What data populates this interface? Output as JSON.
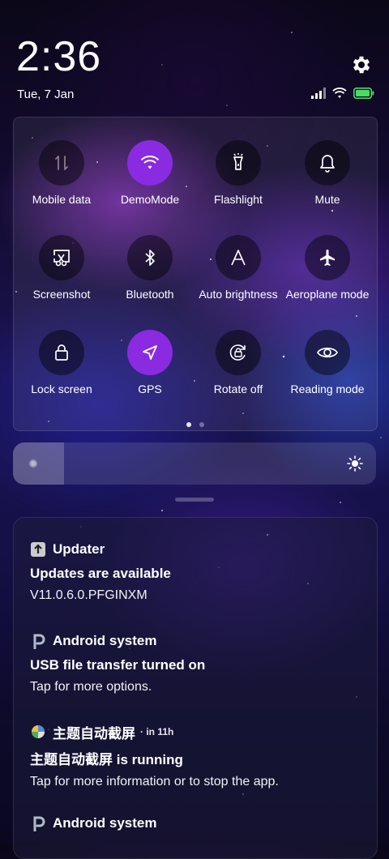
{
  "clock": {
    "time": "2:36",
    "date": "Tue, 7 Jan"
  },
  "colors": {
    "accent": "#8a2be2",
    "battery": "#4cd964"
  },
  "tiles": [
    {
      "label": "Mobile data",
      "icon": "mobile-data-icon",
      "state": "disabled"
    },
    {
      "label": "DemoMode",
      "icon": "wifi-icon",
      "state": "active"
    },
    {
      "label": "Flashlight",
      "icon": "flashlight-icon",
      "state": "off"
    },
    {
      "label": "Mute",
      "icon": "bell-icon",
      "state": "off"
    },
    {
      "label": "Screenshot",
      "icon": "screenshot-icon",
      "state": "off"
    },
    {
      "label": "Bluetooth",
      "icon": "bluetooth-icon",
      "state": "off"
    },
    {
      "label": "Auto brightness",
      "icon": "auto-brightness-icon",
      "state": "off"
    },
    {
      "label": "Aeroplane mode",
      "icon": "airplane-icon",
      "state": "off"
    },
    {
      "label": "Lock screen",
      "icon": "lock-icon",
      "state": "off"
    },
    {
      "label": "GPS",
      "icon": "gps-icon",
      "state": "active"
    },
    {
      "label": "Rotate off",
      "icon": "rotate-lock-icon",
      "state": "off"
    },
    {
      "label": "Reading mode",
      "icon": "eye-icon",
      "state": "off"
    }
  ],
  "pager": {
    "pages": 2,
    "current": 1
  },
  "brightness": {
    "level": 0.14
  },
  "notifications": [
    {
      "app": "Updater",
      "meta": "",
      "title": "Updates are available",
      "text": "V11.0.6.0.PFGINXM",
      "icon": "updater-icon"
    },
    {
      "app": "Android system",
      "meta": "",
      "title": "USB file transfer turned on",
      "text": "Tap for more options.",
      "icon": "android-system-icon"
    },
    {
      "app": "主题自动截屏",
      "meta": "· in 11h",
      "title": "主题自动截屏 is running",
      "text": "Tap for more information or to stop the app.",
      "icon": "theme-app-icon"
    },
    {
      "app": "Android system",
      "meta": "",
      "title": "",
      "text": "",
      "icon": "android-system-icon"
    }
  ]
}
